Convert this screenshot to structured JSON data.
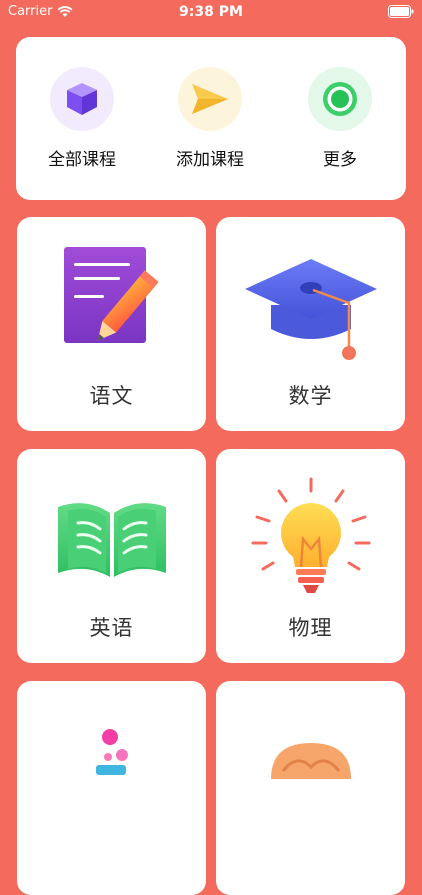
{
  "status": {
    "carrier": "Carrier",
    "time": "9:38 PM"
  },
  "quick_actions": [
    {
      "label": "全部课程",
      "icon": "cube-icon",
      "color": "#8a62f0"
    },
    {
      "label": "添加课程",
      "icon": "send-icon",
      "color": "#f6c542"
    },
    {
      "label": "更多",
      "icon": "more-circle-icon",
      "color": "#31c65f"
    }
  ],
  "subjects": [
    {
      "name": "语文",
      "icon": "notebook-pencil-icon"
    },
    {
      "name": "数学",
      "icon": "graduation-cap-icon"
    },
    {
      "name": "英语",
      "icon": "open-book-icon"
    },
    {
      "name": "物理",
      "icon": "light-bulb-icon"
    },
    {
      "name": "",
      "icon": "flask-icon"
    },
    {
      "name": "",
      "icon": "brain-icon"
    }
  ],
  "colors": {
    "background": "#f46b5d",
    "card": "#ffffff"
  }
}
